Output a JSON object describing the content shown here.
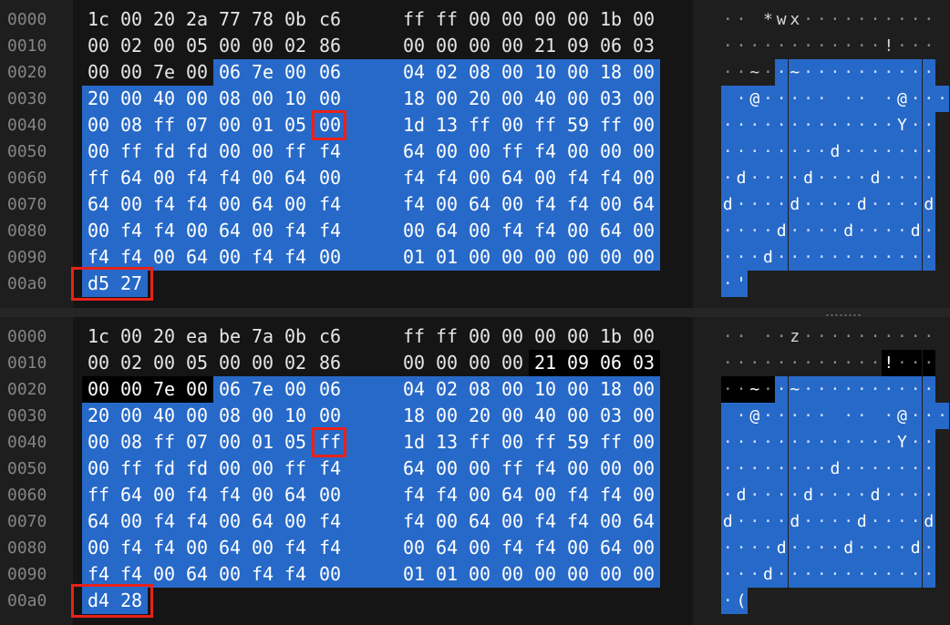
{
  "panes": [
    {
      "name": "top",
      "offsets": [
        "0000",
        "0010",
        "0020",
        "0030",
        "0040",
        "0050",
        "0060",
        "0070",
        "0080",
        "0090",
        "00a0"
      ],
      "rows": [
        [
          "1c",
          "00",
          "20",
          "2a",
          "77",
          "78",
          "0b",
          "c6",
          "ff",
          "ff",
          "00",
          "00",
          "00",
          "00",
          "1b",
          "00"
        ],
        [
          "00",
          "02",
          "00",
          "05",
          "00",
          "00",
          "02",
          "86",
          "00",
          "00",
          "00",
          "00",
          "21",
          "09",
          "06",
          "03"
        ],
        [
          "00",
          "00",
          "7e",
          "00",
          "06",
          "7e",
          "00",
          "06",
          "04",
          "02",
          "08",
          "00",
          "10",
          "00",
          "18",
          "00"
        ],
        [
          "20",
          "00",
          "40",
          "00",
          "08",
          "00",
          "10",
          "00",
          "18",
          "00",
          "20",
          "00",
          "40",
          "00",
          "03",
          "00"
        ],
        [
          "00",
          "08",
          "ff",
          "07",
          "00",
          "01",
          "05",
          "00",
          "1d",
          "13",
          "ff",
          "00",
          "ff",
          "59",
          "ff",
          "00"
        ],
        [
          "00",
          "ff",
          "fd",
          "fd",
          "00",
          "00",
          "ff",
          "f4",
          "64",
          "00",
          "00",
          "ff",
          "f4",
          "00",
          "00",
          "00"
        ],
        [
          "ff",
          "64",
          "00",
          "f4",
          "f4",
          "00",
          "64",
          "00",
          "f4",
          "f4",
          "00",
          "64",
          "00",
          "f4",
          "f4",
          "00"
        ],
        [
          "64",
          "00",
          "f4",
          "f4",
          "00",
          "64",
          "00",
          "f4",
          "f4",
          "00",
          "64",
          "00",
          "f4",
          "f4",
          "00",
          "64"
        ],
        [
          "00",
          "f4",
          "f4",
          "00",
          "64",
          "00",
          "f4",
          "f4",
          "00",
          "64",
          "00",
          "f4",
          "f4",
          "00",
          "64",
          "00"
        ],
        [
          "f4",
          "f4",
          "00",
          "64",
          "00",
          "f4",
          "f4",
          "00",
          "01",
          "01",
          "00",
          "00",
          "00",
          "00",
          "00",
          "00"
        ],
        [
          "d5",
          "27"
        ]
      ],
      "ascii": [
        "·· *wx··········",
        "············!···",
        "··~··~··········",
        " ·@····· ·· ·@···",
        "·············Y··",
        "········d·······",
        "·d····d····d····",
        "d····d····d····d",
        "····d····d····d·",
        "···d············",
        "·'"
      ],
      "selection_start": 36,
      "dark_range": [],
      "changed_byte": 71
    },
    {
      "name": "bottom",
      "offsets": [
        "0000",
        "0010",
        "0020",
        "0030",
        "0040",
        "0050",
        "0060",
        "0070",
        "0080",
        "0090",
        "00a0"
      ],
      "rows": [
        [
          "1c",
          "00",
          "20",
          "ea",
          "be",
          "7a",
          "0b",
          "c6",
          "ff",
          "ff",
          "00",
          "00",
          "00",
          "00",
          "1b",
          "00"
        ],
        [
          "00",
          "02",
          "00",
          "05",
          "00",
          "00",
          "02",
          "86",
          "00",
          "00",
          "00",
          "00",
          "21",
          "09",
          "06",
          "03"
        ],
        [
          "00",
          "00",
          "7e",
          "00",
          "06",
          "7e",
          "00",
          "06",
          "04",
          "02",
          "08",
          "00",
          "10",
          "00",
          "18",
          "00"
        ],
        [
          "20",
          "00",
          "40",
          "00",
          "08",
          "00",
          "10",
          "00",
          "18",
          "00",
          "20",
          "00",
          "40",
          "00",
          "03",
          "00"
        ],
        [
          "00",
          "08",
          "ff",
          "07",
          "00",
          "01",
          "05",
          "ff",
          "1d",
          "13",
          "ff",
          "00",
          "ff",
          "59",
          "ff",
          "00"
        ],
        [
          "00",
          "ff",
          "fd",
          "fd",
          "00",
          "00",
          "ff",
          "f4",
          "64",
          "00",
          "00",
          "ff",
          "f4",
          "00",
          "00",
          "00"
        ],
        [
          "ff",
          "64",
          "00",
          "f4",
          "f4",
          "00",
          "64",
          "00",
          "f4",
          "f4",
          "00",
          "64",
          "00",
          "f4",
          "f4",
          "00"
        ],
        [
          "64",
          "00",
          "f4",
          "f4",
          "00",
          "64",
          "00",
          "f4",
          "f4",
          "00",
          "64",
          "00",
          "f4",
          "f4",
          "00",
          "64"
        ],
        [
          "00",
          "f4",
          "f4",
          "00",
          "64",
          "00",
          "f4",
          "f4",
          "00",
          "64",
          "00",
          "f4",
          "f4",
          "00",
          "64",
          "00"
        ],
        [
          "f4",
          "f4",
          "00",
          "64",
          "00",
          "f4",
          "f4",
          "00",
          "01",
          "01",
          "00",
          "00",
          "00",
          "00",
          "00",
          "00"
        ],
        [
          "d4",
          "28"
        ]
      ],
      "ascii": [
        "·· ··z··········",
        "············!···",
        "··~··~··········",
        " ·@····· ·· ·@···",
        "·············Y··",
        "········d·······",
        "·d····d····d····",
        "d····d····d····d",
        "····d····d····d·",
        "···d············",
        "·("
      ],
      "selection_start": 36,
      "dark_range": [
        28,
        35
      ],
      "changed_byte": 71
    }
  ],
  "colors": {
    "background": "#1e1e1e",
    "selection": "#2769c8",
    "highlight": "#e8221a",
    "offset_text": "#858585"
  }
}
